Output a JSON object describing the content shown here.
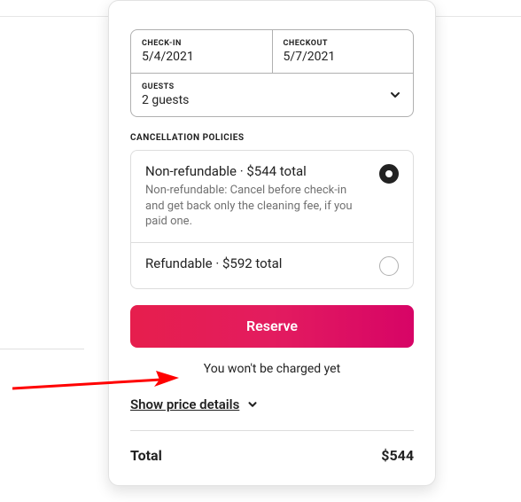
{
  "dates": {
    "checkin_label": "CHECK-IN",
    "checkin_value": "5/4/2021",
    "checkout_label": "CHECKOUT",
    "checkout_value": "5/7/2021"
  },
  "guests": {
    "label": "GUESTS",
    "value": "2 guests"
  },
  "policies": {
    "section_label": "CANCELLATION POLICIES",
    "options": [
      {
        "title": "Non-refundable · $544 total",
        "description": "Non-refundable: Cancel before check-in and get back only the cleaning fee, if you paid one."
      },
      {
        "title": "Refundable · $592 total",
        "description": ""
      }
    ]
  },
  "reserve_label": "Reserve",
  "charge_note": "You won't be charged yet",
  "show_details_label": "Show price details",
  "total": {
    "label": "Total",
    "value": "$544"
  }
}
